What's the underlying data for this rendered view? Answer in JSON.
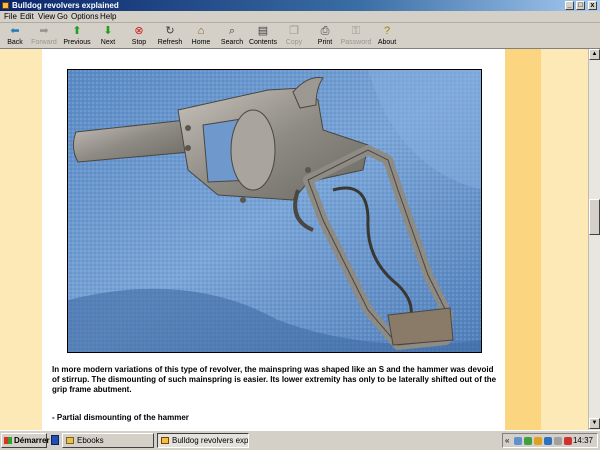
{
  "window": {
    "title": "Bulldog revolvers explained",
    "controls": {
      "minimize": "_",
      "maximize": "□",
      "close": "x"
    }
  },
  "menu": [
    "File",
    "Edit",
    "View",
    "Go",
    "Options",
    "Help"
  ],
  "toolbar": [
    {
      "label": "Back",
      "icon": "back-arrow-icon",
      "enabled": true
    },
    {
      "label": "Forward",
      "icon": "forward-arrow-icon",
      "enabled": false
    },
    {
      "label": "Previous",
      "icon": "up-arrow-icon",
      "enabled": true
    },
    {
      "label": "Next",
      "icon": "down-arrow-icon",
      "enabled": true
    },
    {
      "label": "Stop",
      "icon": "stop-icon",
      "enabled": true
    },
    {
      "label": "Refresh",
      "icon": "refresh-icon",
      "enabled": true
    },
    {
      "label": "Home",
      "icon": "home-icon",
      "enabled": true
    },
    {
      "label": "Search",
      "icon": "search-icon",
      "enabled": true
    },
    {
      "label": "Contents",
      "icon": "contents-icon",
      "enabled": true
    },
    {
      "label": "Copy",
      "icon": "copy-icon",
      "enabled": false
    },
    {
      "label": "Print",
      "icon": "print-icon",
      "enabled": true
    },
    {
      "label": "Password",
      "icon": "key-icon",
      "enabled": false
    },
    {
      "label": "About",
      "icon": "about-icon",
      "enabled": true
    }
  ],
  "content": {
    "paragraph": "In more modern variations of this type of revolver, the mainspring was shaped like an S and the hammer was devoid of stirrup. The dismounting of such mainspring is easier. Its lower extremity has only to be laterally shifted out of the grip frame abutment.",
    "subheading": "- Partial dismounting of the hammer"
  },
  "colors": {
    "page_background": "#fde9b6",
    "right_band": "#fcd581",
    "titlebar": "#0a246a"
  },
  "taskbar": {
    "start_label": "Démarrer",
    "tasks": [
      {
        "label": "Ebooks",
        "active": false
      },
      {
        "label": "Bulldog revolvers exp...",
        "active": true
      }
    ],
    "tray_expand": "«",
    "clock": "14:37"
  }
}
